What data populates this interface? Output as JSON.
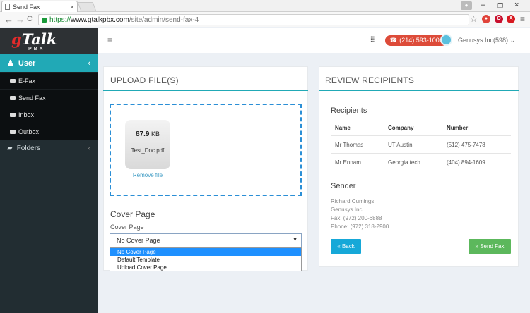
{
  "browser": {
    "tab_title": "Send Fax",
    "tab_close": "×",
    "url_proto": "https://",
    "url_host": "www.gtalkpbx.com",
    "url_path": "/site/admin/send-fax-4",
    "win_minimize": "–",
    "win_maximize": "❐",
    "win_close": "×",
    "back": "←",
    "forward": "→",
    "reload": "C",
    "star": "☆",
    "menu": "≡"
  },
  "app": {
    "logo_g": "g",
    "logo_rest": "Talk",
    "logo_pbx": "PBX",
    "hamburger": "≡",
    "grid": "⁞⁞⁞",
    "phone": "(214) 593-1004",
    "company": "Genusys Inc(598)",
    "company_caret": "⌄"
  },
  "sidebar": {
    "user_label": "User",
    "user_chevron": "‹",
    "items": [
      {
        "label": "E-Fax"
      },
      {
        "label": "Send Fax"
      },
      {
        "label": "Inbox"
      },
      {
        "label": "Outbox"
      }
    ],
    "folders_label": "Folders",
    "folders_chevron": "‹"
  },
  "upload": {
    "title": "UPLOAD FILE(S)",
    "file_size_value": "87.9",
    "file_size_unit": "KB",
    "file_name": "Test_Doc.pdf",
    "remove_label": "Remove file",
    "cover_heading": "Cover Page",
    "cover_label": "Cover Page",
    "selected": "No Cover Page",
    "options": [
      "No Cover Page",
      "Default Template",
      "Upload Cover Page"
    ]
  },
  "review": {
    "title": "REVIEW RECIPIENTS",
    "recipients_heading": "Recipients",
    "columns": [
      "Name",
      "Company",
      "Number"
    ],
    "rows": [
      {
        "name": "Mr Thomas",
        "company": "UT Austin",
        "number": "(512) 475-7478"
      },
      {
        "name": "Mr Ennam",
        "company": "Georgia tech",
        "number": "(404) 894-1609"
      }
    ],
    "sender_heading": "Sender",
    "sender": {
      "name": "Richard Cumings",
      "company": "Genusys Inc.",
      "fax": "Fax: (972) 200-6888",
      "phone": "Phone: (972) 318-2900"
    },
    "back_label": "« Back",
    "send_label": "» Send Fax"
  },
  "colors": {
    "accent": "#21a9b6",
    "sidebar_bg": "#222d32",
    "phone_pill": "#dd4b39",
    "back_button": "#16a8d8",
    "send_button": "#5cb85c",
    "dropzone_border": "#2b8fd6"
  }
}
